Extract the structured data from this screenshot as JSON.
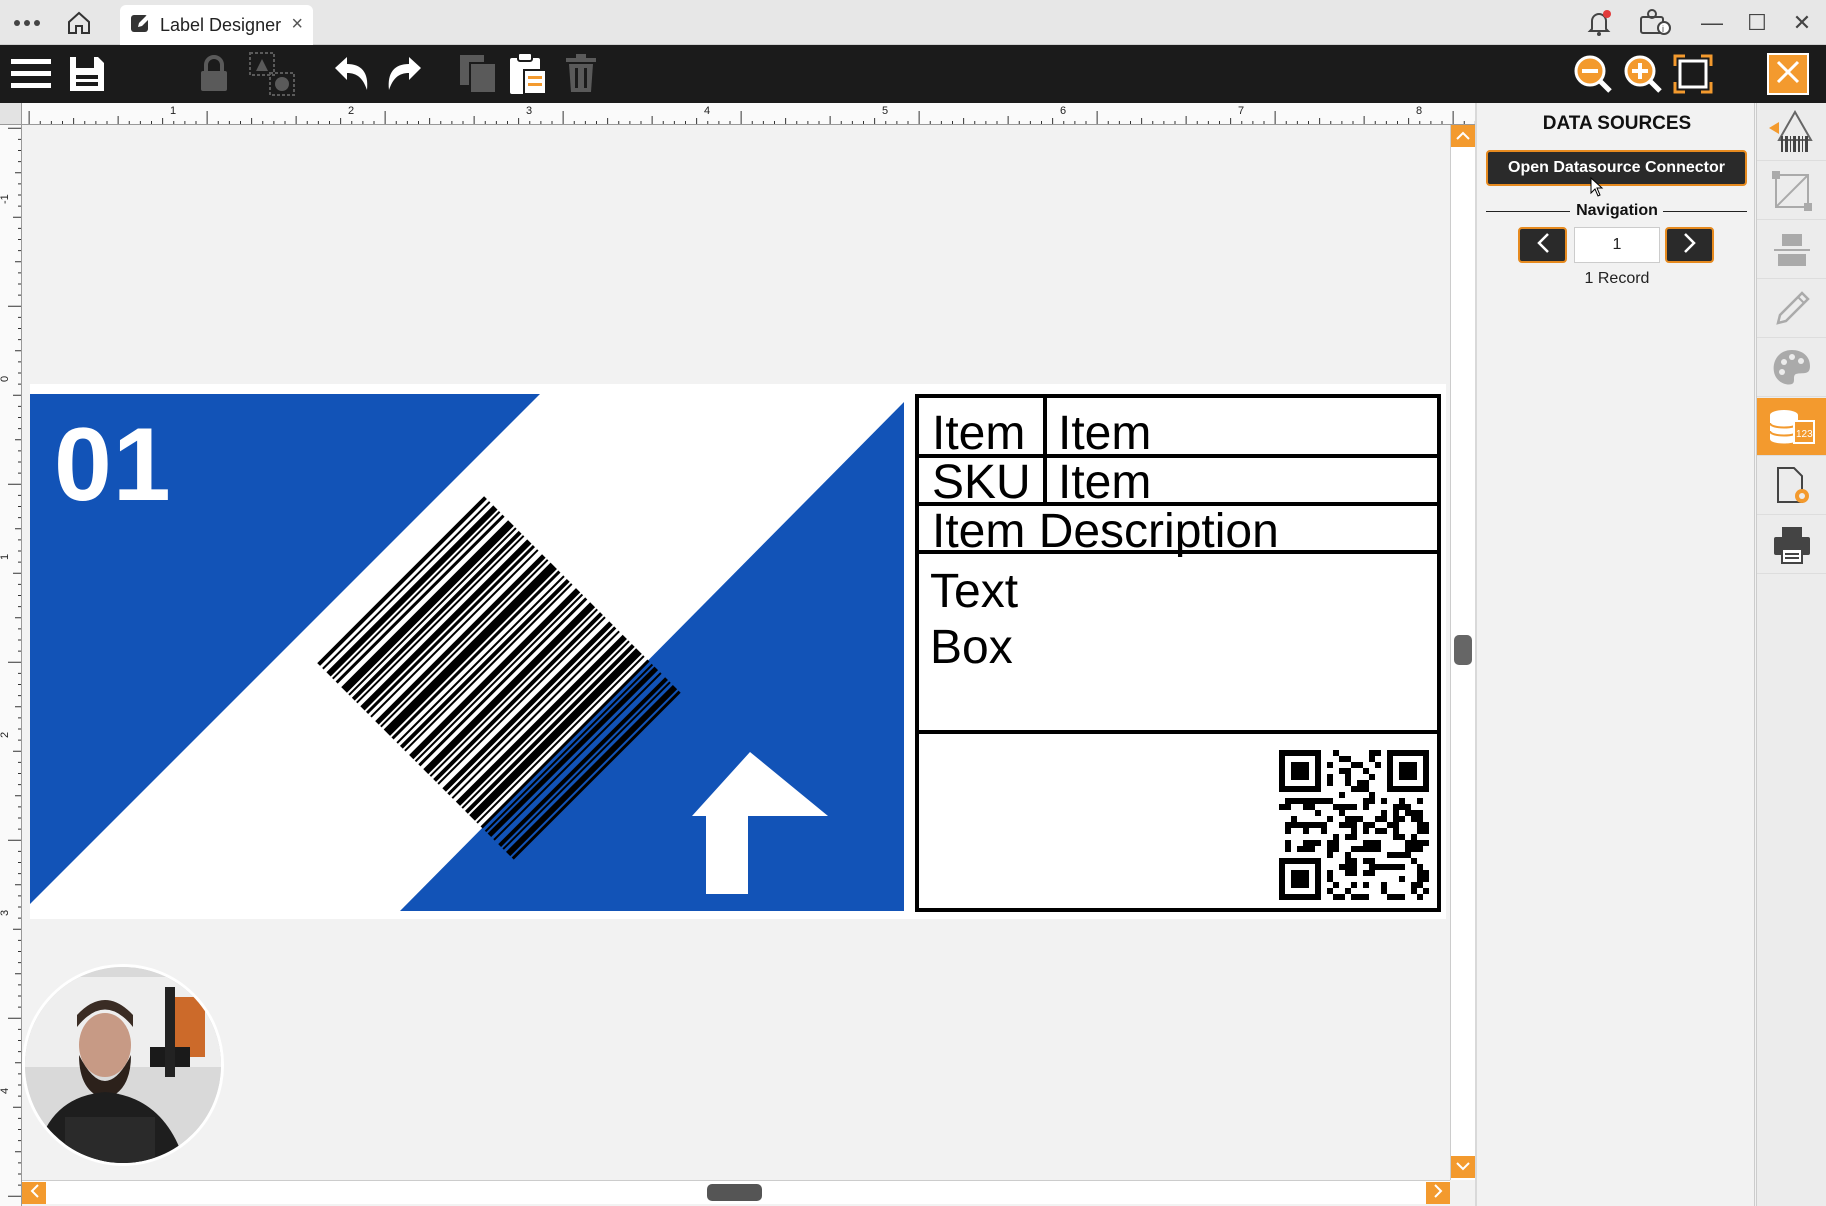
{
  "titlebar": {
    "tab_label": "Label Designer",
    "tab_close": "×",
    "icons": [
      "more-icon",
      "home-icon",
      "edit-icon",
      "bell-icon",
      "user-info-icon"
    ],
    "window_controls": {
      "minimize": "—",
      "maximize": "☐",
      "close": "✕"
    }
  },
  "toolbar": {
    "icons": [
      "menu-icon",
      "save-icon",
      "lock-icon",
      "group-icon",
      "undo-icon",
      "redo-icon",
      "copy-icon",
      "paste-icon",
      "delete-icon",
      "zoom-out-icon",
      "zoom-in-icon",
      "fit-to-screen-icon",
      "close-icon"
    ],
    "accent_color": "#f39a2e"
  },
  "rulers": {
    "top_labels": [
      "1",
      "2",
      "3",
      "4",
      "5",
      "6",
      "7",
      "8"
    ],
    "left_labels": [
      "-1",
      "0",
      "1",
      "2",
      "3",
      "4"
    ]
  },
  "label": {
    "big_number": "01",
    "blue_color": "#1253b7",
    "table": {
      "row1_left": "Item",
      "row1_right": "Item",
      "row2_left": "SKU",
      "row2_right": "Item",
      "description": "Item Description",
      "textbox_line1": "Text",
      "textbox_line2": "Box"
    }
  },
  "panel": {
    "title": "DATA SOURCES",
    "connector_button": "Open Datasource Connector",
    "navigation_label": "Navigation",
    "record_input_value": "1",
    "record_count": "1 Record"
  },
  "dock": {
    "icons": [
      "barcode-tool-icon",
      "shape-tool-icon",
      "align-tool-icon",
      "pencil-icon",
      "palette-icon",
      "database-icon",
      "document-settings-icon",
      "print-icon"
    ],
    "active": "database-icon"
  }
}
